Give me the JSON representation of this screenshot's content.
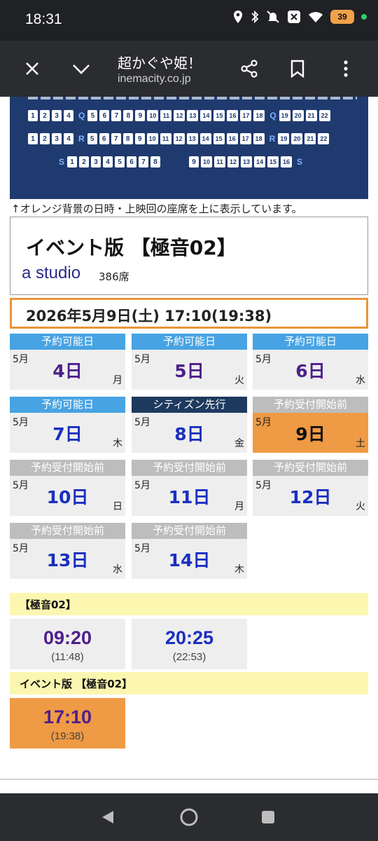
{
  "status": {
    "time": "18:31",
    "battery": "39"
  },
  "toolbar": {
    "title": "超かぐや姫！",
    "url": "inemacity.co.jp"
  },
  "seatmap": {
    "rowP": {
      "left": [
        "1",
        "2",
        "3",
        "4"
      ],
      "label": "Q",
      "mid": [
        "5",
        "6",
        "7",
        "8",
        "9",
        "10",
        "11",
        "12",
        "13",
        "14",
        "15",
        "16",
        "17",
        "18"
      ],
      "label2": "Q",
      "right": [
        "19",
        "20",
        "21",
        "22"
      ]
    },
    "rowR": {
      "left": [
        "1",
        "2",
        "3",
        "4"
      ],
      "label": "R",
      "mid": [
        "5",
        "6",
        "7",
        "8",
        "9",
        "10",
        "11",
        "12",
        "13",
        "14",
        "15",
        "16",
        "17",
        "18"
      ],
      "label2": "R",
      "right": [
        "19",
        "20",
        "21",
        "22"
      ]
    },
    "rowS": {
      "label": "S",
      "left": [
        "1",
        "2",
        "3",
        "4",
        "5",
        "6",
        "7",
        "8"
      ],
      "right": [
        "9",
        "10",
        "11",
        "12",
        "13",
        "14",
        "15",
        "16"
      ],
      "label2": "S"
    }
  },
  "notice": "↑オレンジ背景の日時・上映回の座席を上に表示しています。",
  "event": {
    "title": "イベント版 【極音02】",
    "studio": "a studio",
    "seats": "386席"
  },
  "selected_date": "2026年5月9日(土) 17:10(19:38)",
  "days": [
    {
      "status": "予約可能日",
      "month": "5月",
      "day": "4日",
      "weekday": "月"
    },
    {
      "status": "予約可能日",
      "month": "5月",
      "day": "5日",
      "weekday": "火"
    },
    {
      "status": "予約可能日",
      "month": "5月",
      "day": "6日",
      "weekday": "水"
    },
    {
      "status": "予約可能日",
      "month": "5月",
      "day": "7日",
      "weekday": "木"
    },
    {
      "status": "シティズン先行",
      "month": "5月",
      "day": "8日",
      "weekday": "金"
    },
    {
      "status": "予約受付開始前",
      "month": "5月",
      "day": "9日",
      "weekday": "土"
    },
    {
      "status": "予約受付開始前",
      "month": "5月",
      "day": "10日",
      "weekday": "日"
    },
    {
      "status": "予約受付開始前",
      "month": "5月",
      "day": "11日",
      "weekday": "月"
    },
    {
      "status": "予約受付開始前",
      "month": "5月",
      "day": "12日",
      "weekday": "火"
    },
    {
      "status": "予約受付開始前",
      "month": "5月",
      "day": "13日",
      "weekday": "水"
    },
    {
      "status": "予約受付開始前",
      "month": "5月",
      "day": "14日",
      "weekday": "木"
    }
  ],
  "showtimes": {
    "group1": {
      "label": "【極音02】",
      "items": [
        {
          "time": "09:20",
          "end": "(11:48)"
        },
        {
          "time": "20:25",
          "end": "(22:53)"
        }
      ]
    },
    "group2": {
      "label": "イベント版 【極音02】",
      "items": [
        {
          "time": "17:10",
          "end": "(19:38)"
        }
      ]
    }
  },
  "colors": {
    "accent_orange": "#ef9a45",
    "navy": "#1f3a6e",
    "sky": "#47a3e3",
    "purple": "#4e1f8c",
    "blue": "#1a2fc0"
  }
}
